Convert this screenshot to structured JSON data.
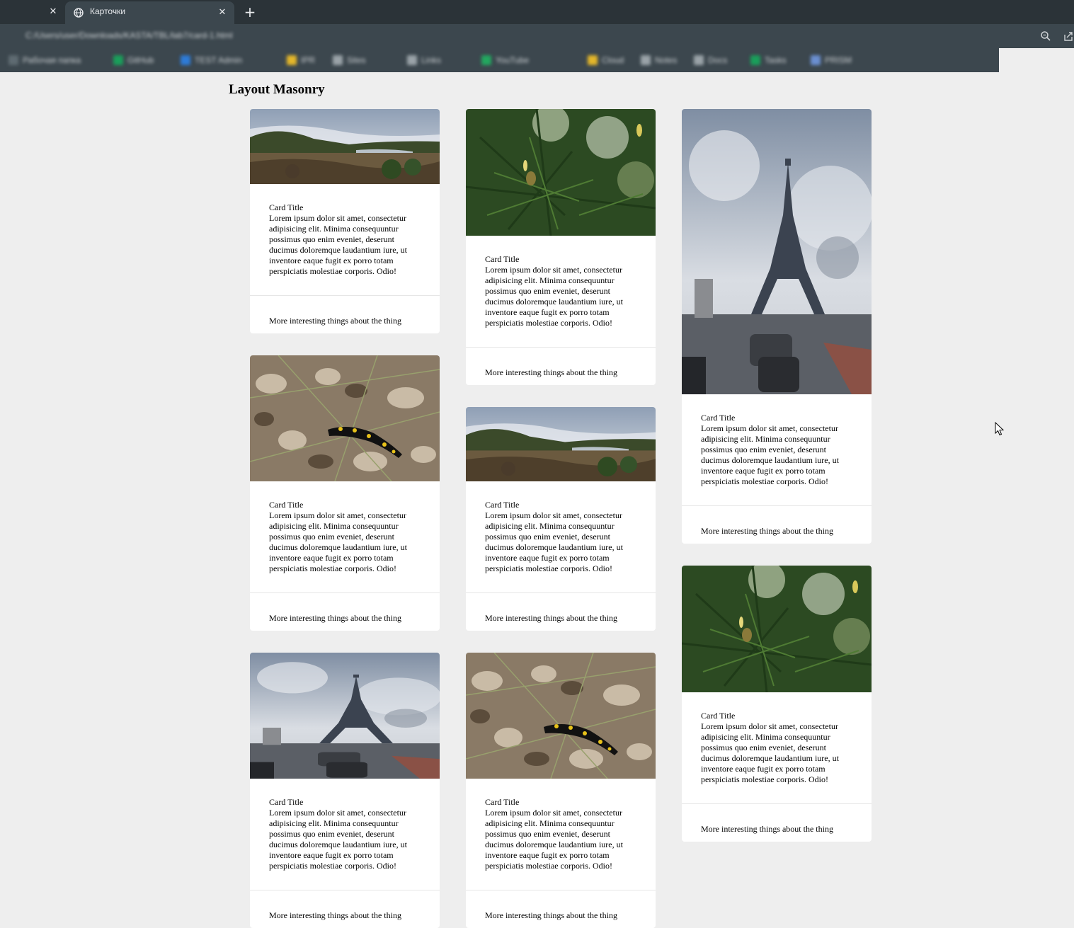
{
  "browser": {
    "active_tab_title": "Карточки",
    "address": "C:/Users/user/Downloads/KASTA/TBL/lab7/card-1.html",
    "bookmarks": [
      "Рабочая папка",
      "GitHub",
      "TEST Admin",
      "IPR",
      "Sites",
      "Links",
      "YouTube",
      "Cloud",
      "Notes",
      "Docs",
      "Tasks",
      "PRISM"
    ],
    "bookmark_colors": [
      "#5f6b72",
      "#1a9e5a",
      "#2e7bd6",
      "#e3b62a",
      "#9aa3a8",
      "#9aa3a8",
      "#23a65f",
      "#e3b62a",
      "#9aa3a8",
      "#9aa3a8",
      "#1a9e5a",
      "#6b8fd0"
    ]
  },
  "page": {
    "title": "Layout Masonry"
  },
  "card_text": {
    "title": "Card Title",
    "body": "Lorem ipsum dolor sit amet, consectetur adipisicing elit. Minima consequuntur possimus quo enim eveniet, deserunt ducimus doloremque laudantium iure, ut inventore eaque fugit ex porro totam perspiciatis molestiae corporis. Odio!",
    "footer": "More interesting things about the thing"
  },
  "cards": [
    {
      "image": "landscape-lake-photo",
      "title": "Card Title",
      "footer": "More interesting things about the thing"
    },
    {
      "image": "salamander-photo",
      "title": "Card Title",
      "footer": "More interesting things about the thing"
    },
    {
      "image": "eiffel-tower-photo",
      "title": "Card Title",
      "footer": "More interesting things about the thing"
    },
    {
      "image": "pine-branch-photo",
      "title": "Card Title",
      "footer": "More interesting things about the thing"
    },
    {
      "image": "landscape-lake-photo",
      "title": "Card Title",
      "footer": "More interesting things about the thing"
    },
    {
      "image": "salamander-photo",
      "title": "Card Title",
      "footer": "More interesting things about the thing"
    },
    {
      "image": "eiffel-tower-photo",
      "title": "Card Title",
      "footer": "More interesting things about the thing"
    },
    {
      "image": "pine-branch-photo",
      "title": "Card Title",
      "footer": "More interesting things about the thing"
    }
  ]
}
